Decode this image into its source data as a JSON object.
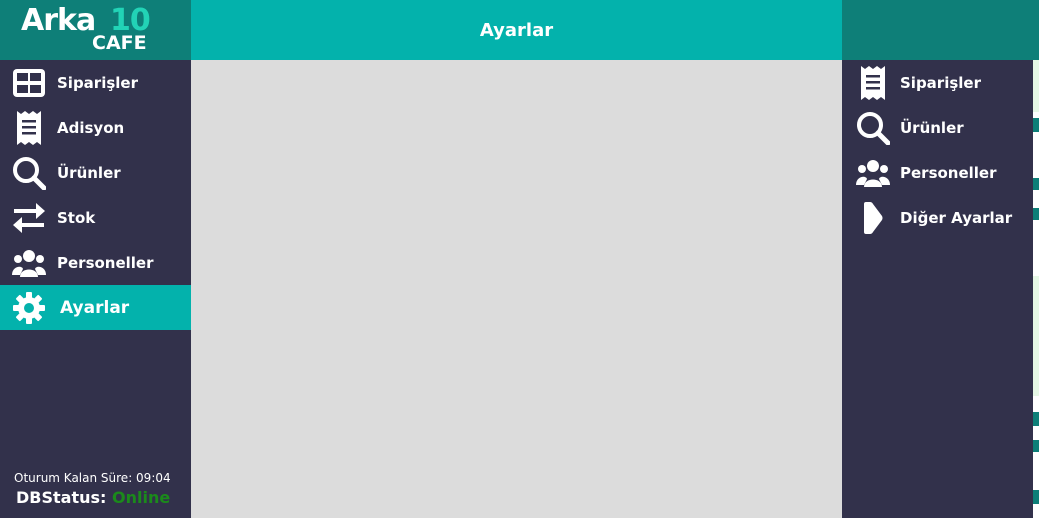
{
  "logo": {
    "word": "Arka",
    "number": "10",
    "sub": "CAFE"
  },
  "header": {
    "title": "Ayarlar"
  },
  "sidebar": {
    "items": [
      {
        "label": "Siparişler",
        "icon": "grid-icon",
        "active": false
      },
      {
        "label": "Adisyon",
        "icon": "receipt-icon",
        "active": false
      },
      {
        "label": "Ürünler",
        "icon": "search-icon",
        "active": false
      },
      {
        "label": "Stok",
        "icon": "swap-arrows-icon",
        "active": false
      },
      {
        "label": "Personeller",
        "icon": "users-icon",
        "active": false
      },
      {
        "label": "Ayarlar",
        "icon": "gear-icon",
        "active": true
      }
    ],
    "session": "Oturum Kalan Süre: 09:04",
    "db_label": "DBStatus:",
    "db_value": "Online"
  },
  "settings_menu": {
    "items": [
      {
        "label": "Siparişler",
        "icon": "receipt-icon"
      },
      {
        "label": "Ürünler",
        "icon": "search-icon"
      },
      {
        "label": "Personeller",
        "icon": "users-icon"
      },
      {
        "label": "Diğer Ayarlar",
        "icon": "chevron-right-icon"
      }
    ]
  },
  "colors": {
    "sidebar_bg": "#32314b",
    "accent": "#03b2ac",
    "dark_teal": "#0e7f78",
    "content_bg": "#dcdcdc",
    "online": "#1b8a1b"
  }
}
